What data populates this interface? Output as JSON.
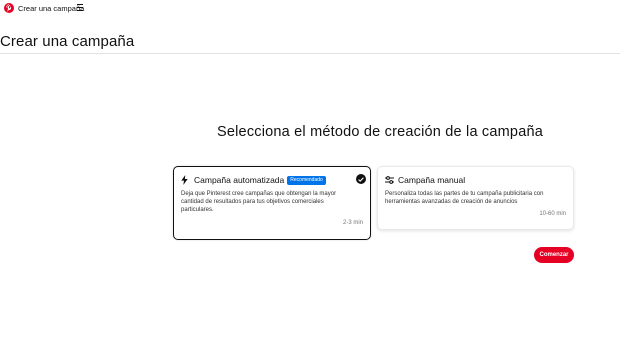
{
  "app": {
    "title": "Crear una campaña",
    "brand_color": "#e60023",
    "icons": {
      "logo": "pinterest-logo-icon",
      "menu": "menu-icon"
    }
  },
  "page": {
    "title": "Crear una campaña",
    "heading": "Selecciona el método de creación de la campaña"
  },
  "options": [
    {
      "icon": "lightning-bolt-icon",
      "title": "Campaña automatizada",
      "badge": "Recomendado",
      "badge_color": "#0074e8",
      "description": "Deja que Pinterest cree campañas que obtengan la mayor cantidad de resultados para tus objetivos comerciales particulares.",
      "time": "2-3 min",
      "selected": true
    },
    {
      "icon": "sliders-icon",
      "title": "Campaña manual",
      "description": "Personaliza todas las partes de tu campaña publicitaria con herramientas avanzadas de creación de anuncios",
      "time": "10-60 min",
      "selected": false
    }
  ],
  "actions": {
    "start_label": "Comenzar"
  }
}
